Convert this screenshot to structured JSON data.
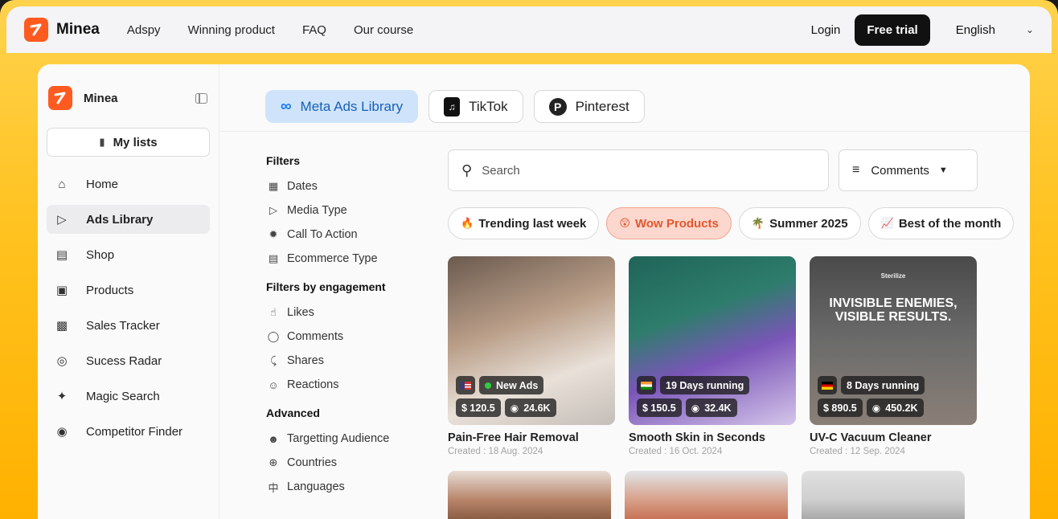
{
  "topbar": {
    "brand": "Minea",
    "nav": [
      "Adspy",
      "Winning product",
      "FAQ",
      "Our course"
    ],
    "login": "Login",
    "free_trial": "Free trial",
    "language": "English"
  },
  "sidebar": {
    "title": "Minea",
    "my_lists": "My lists",
    "items": [
      {
        "label": "Home",
        "icon": "home-icon",
        "active": false
      },
      {
        "label": "Ads Library",
        "icon": "ads-library-icon",
        "active": true
      },
      {
        "label": "Shop",
        "icon": "shop-icon",
        "active": false
      },
      {
        "label": "Products",
        "icon": "products-icon",
        "active": false
      },
      {
        "label": "Sales Tracker",
        "icon": "sales-tracker-icon",
        "active": false
      },
      {
        "label": "Sucess Radar",
        "icon": "radar-icon",
        "active": false
      },
      {
        "label": "Magic Search",
        "icon": "magic-wand-icon",
        "active": false
      },
      {
        "label": "Competitor Finder",
        "icon": "competitor-icon",
        "active": false
      }
    ]
  },
  "source_tabs": [
    "Meta Ads Library",
    "TikTok",
    "Pinterest"
  ],
  "filters": {
    "heading": "Filters",
    "items": [
      "Dates",
      "Media Type",
      "Call To Action",
      "Ecommerce Type"
    ],
    "engagement_heading": "Filters by engagement",
    "engagement_items": [
      "Likes",
      "Comments",
      "Shares",
      "Reactions"
    ],
    "advanced_heading": "Advanced",
    "advanced_items": [
      "Targetting Audience",
      "Countries",
      "Languages"
    ]
  },
  "search": {
    "placeholder": "Search"
  },
  "sort": {
    "label": "Comments"
  },
  "chips": [
    {
      "label": "Trending last week",
      "emoji": "🔥",
      "active": false
    },
    {
      "label": "Wow Products",
      "emoji": "😲",
      "active": true
    },
    {
      "label": "Summer 2025",
      "emoji": "🌴",
      "active": false
    },
    {
      "label": "Best of the month",
      "emoji": "📈",
      "active": false
    }
  ],
  "cards": [
    {
      "title": "Pain-Free Hair Removal",
      "date": "Created : 18 Aug. 2024",
      "status": "New Ads",
      "price": "$ 120.5",
      "views": "24.6K",
      "country": "US"
    },
    {
      "title": "Smooth Skin in Seconds",
      "date": "Created : 16 Oct. 2024",
      "status": "19 Days running",
      "price": "$ 150.5",
      "views": "32.4K",
      "country": "IN"
    },
    {
      "title": "UV-C Vacuum Cleaner",
      "date": "Created : 12 Sep. 2024",
      "status": "8 Days running",
      "price": "$ 890.5",
      "views": "450.2K",
      "country": "DE",
      "ad_text": "INVISIBLE ENEMIES, VISIBLE RESULTS.",
      "ad_brand": "Sterilize"
    }
  ]
}
